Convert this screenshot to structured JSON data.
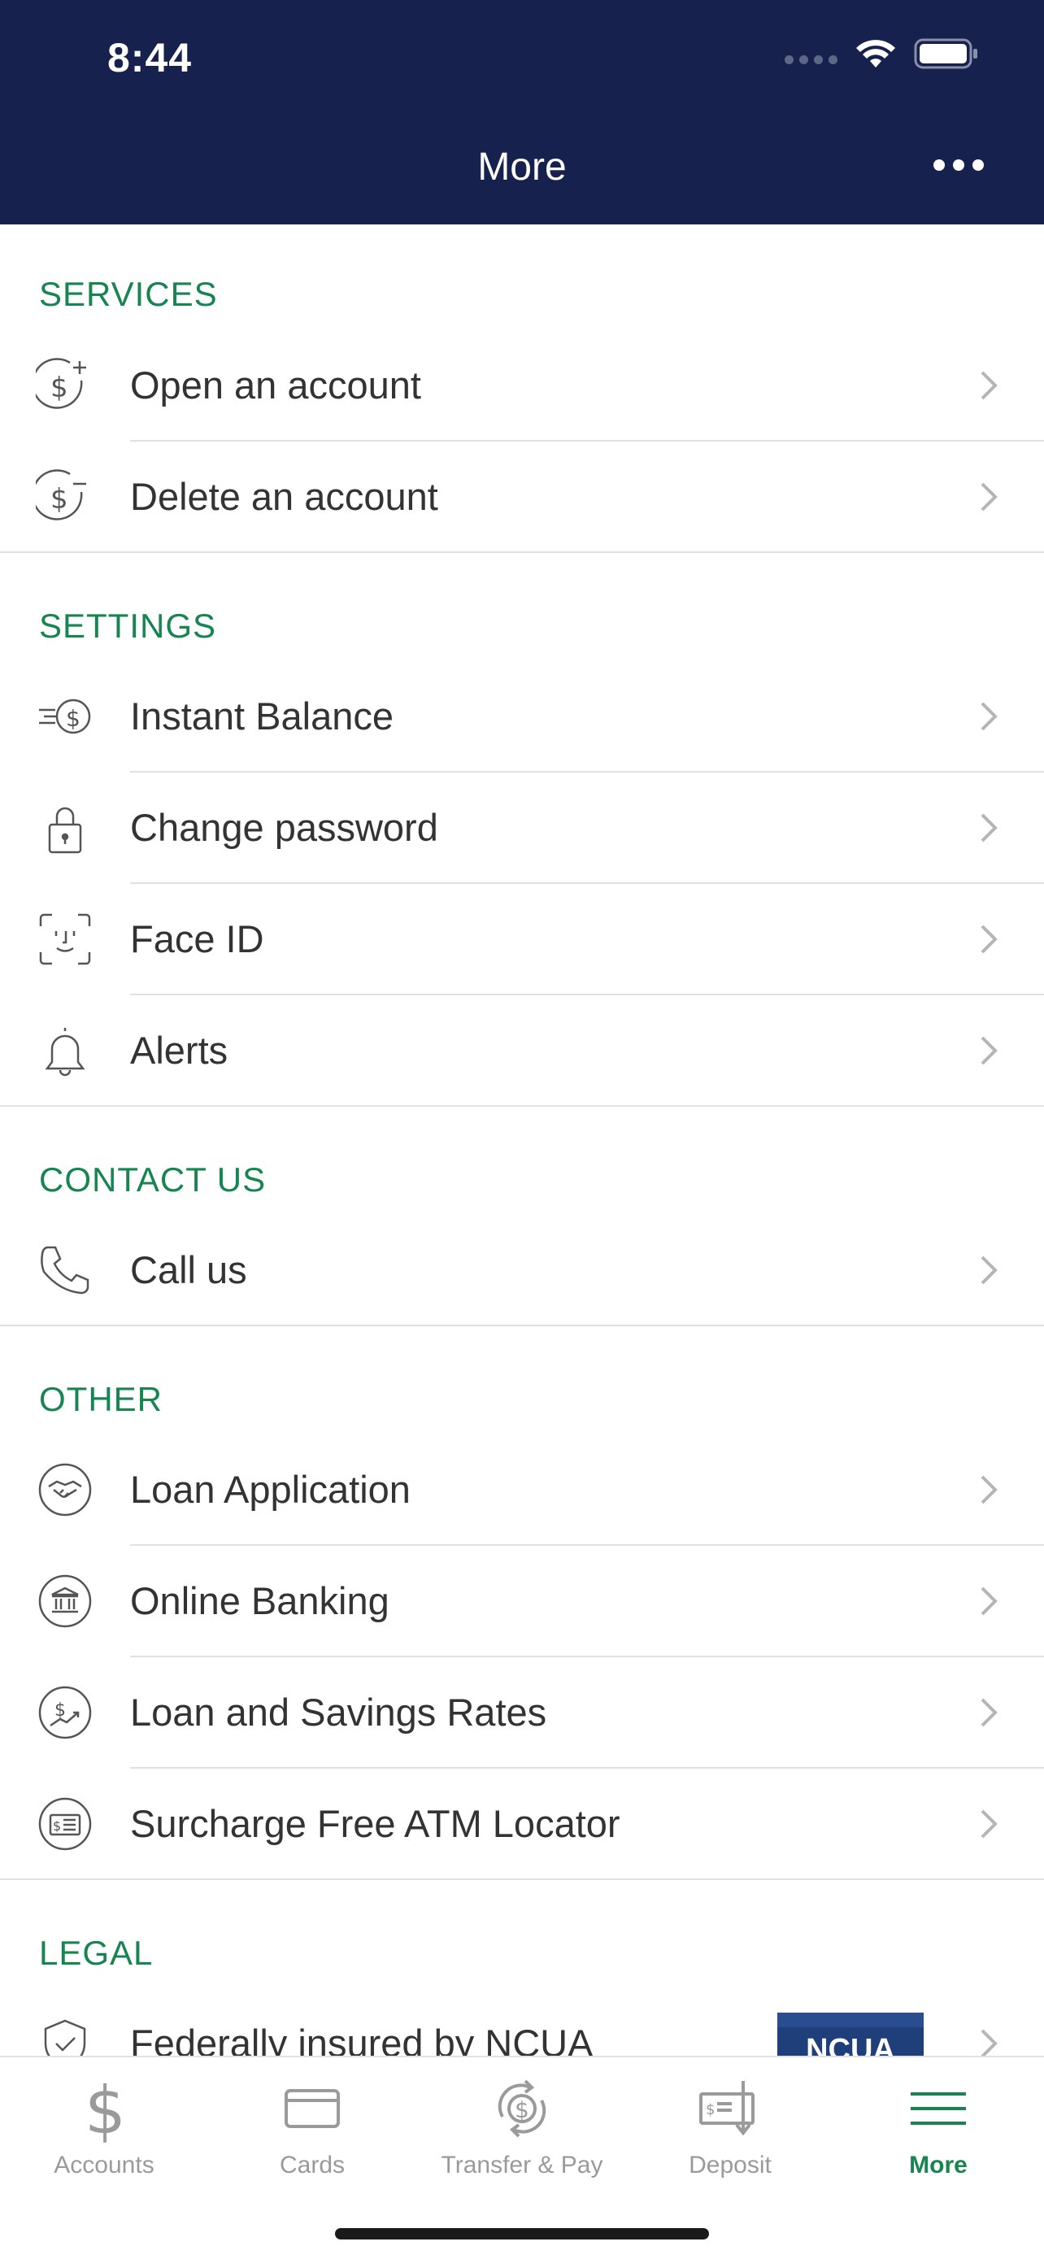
{
  "status_bar": {
    "time": "8:44"
  },
  "header": {
    "title": "More"
  },
  "sections": {
    "services": {
      "title": "SERVICES",
      "items": [
        {
          "label": "Open an account",
          "icon": "dollar-plus-icon"
        },
        {
          "label": "Delete an account",
          "icon": "dollar-minus-icon"
        }
      ]
    },
    "settings": {
      "title": "SETTINGS",
      "items": [
        {
          "label": "Instant Balance",
          "icon": "fast-dollar-icon"
        },
        {
          "label": "Change password",
          "icon": "lock-icon"
        },
        {
          "label": "Face ID",
          "icon": "face-id-icon"
        },
        {
          "label": "Alerts",
          "icon": "bell-icon"
        }
      ]
    },
    "contact": {
      "title": "CONTACT US",
      "items": [
        {
          "label": "Call us",
          "icon": "phone-icon"
        }
      ]
    },
    "other": {
      "title": "OTHER",
      "items": [
        {
          "label": "Loan Application",
          "icon": "handshake-icon"
        },
        {
          "label": "Online Banking",
          "icon": "bank-icon"
        },
        {
          "label": "Loan and Savings Rates",
          "icon": "rates-icon"
        },
        {
          "label": "Surcharge Free ATM Locator",
          "icon": "atm-card-icon"
        }
      ]
    },
    "legal": {
      "title": "LEGAL",
      "items": [
        {
          "label": "Federally insured by NCUA",
          "icon": "shield-check-icon",
          "logo_text": "NCUA"
        }
      ]
    }
  },
  "tabbar": {
    "items": [
      {
        "label": "Accounts",
        "icon": "dollar-icon"
      },
      {
        "label": "Cards",
        "icon": "card-icon"
      },
      {
        "label": "Transfer & Pay",
        "icon": "transfer-icon"
      },
      {
        "label": "Deposit",
        "icon": "deposit-check-icon"
      },
      {
        "label": "More",
        "icon": "menu-icon",
        "active": true
      }
    ]
  },
  "colors": {
    "header_bg": "#16224d",
    "accent_green": "#16854f",
    "text": "#333333",
    "inactive_tab": "#9a9a9a"
  }
}
